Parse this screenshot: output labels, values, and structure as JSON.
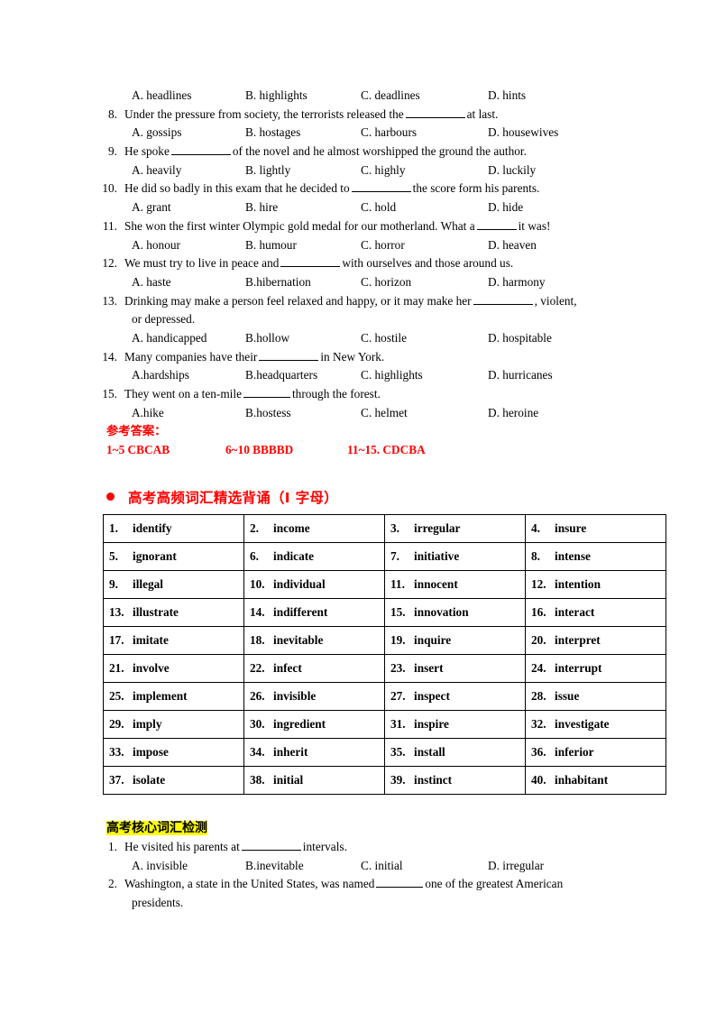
{
  "document": {
    "title": "高考词汇练习 - I 字母",
    "colors": {
      "answer_red": "#FF0000",
      "highlight_yellow": "#FFFF00",
      "text_black": "#000000"
    }
  },
  "quiz_top": {
    "orphan_options": [
      "A. headlines",
      "B. highlights",
      "C. deadlines",
      "D. hints"
    ],
    "questions": [
      {
        "num": "8.",
        "stem_before": "Under the pressure from society, the terrorists released the",
        "blank": "long",
        "stem_after": "at last.",
        "options": [
          "A. gossips",
          "B. hostages",
          "C. harbours",
          "D. housewives"
        ]
      },
      {
        "num": "9.",
        "stem_before": "He spoke",
        "blank": "long",
        "stem_after": "of the novel and he almost worshipped the ground the author.",
        "options": [
          "A. heavily",
          "B. lightly",
          "C. highly",
          "D. luckily"
        ]
      },
      {
        "num": "10.",
        "stem_before": "He did so badly in this exam that he decided to",
        "blank": "long",
        "stem_after": "the score form his parents.",
        "options": [
          "A. grant",
          "B. hire",
          "C. hold",
          "D. hide"
        ]
      },
      {
        "num": "11.",
        "stem_before": "She won the first winter Olympic gold medal for our motherland. What a",
        "blank": "short",
        "stem_after": "it was!",
        "options": [
          "A. honour",
          "B. humour",
          "C. horror",
          "D. heaven"
        ]
      },
      {
        "num": "12.",
        "stem_before": "We must try to live in peace and",
        "blank": "long",
        "stem_after": "with ourselves and those around us.",
        "options": [
          "A. haste",
          "B.hibernation",
          "C. horizon",
          "D. harmony"
        ]
      },
      {
        "num": "13.",
        "stem_before": "Drinking may make a person feel relaxed and happy, or it may make her",
        "blank": "long",
        "stem_after": ", violent,",
        "continuation": "or depressed.",
        "options": [
          "A. handicapped",
          "B.hollow",
          "C. hostile",
          "D. hospitable"
        ]
      },
      {
        "num": "14.",
        "stem_before": "Many companies have their",
        "blank": "long",
        "stem_after": "in New York.",
        "options": [
          "A.hardships",
          "B.headquarters",
          "C. highlights",
          "D. hurricanes"
        ]
      },
      {
        "num": "15.",
        "stem_before": "They went on a ten-mile",
        "blank": "mid",
        "stem_after": "through the forest.",
        "options": [
          "A.hike",
          "B.hostess",
          "C. helmet",
          "D. heroine"
        ]
      }
    ]
  },
  "answer_key": {
    "title": "参考答案：",
    "segments": [
      "1~5    CBCAB",
      "6~10   BBBBD",
      "11~15. CDCBA"
    ]
  },
  "vocab_section": {
    "heading": "高考高频词汇精选背诵（Ⅰ 字母）",
    "bullet_icon": "bullet-dot-icon",
    "rows": [
      [
        {
          "num": "1.",
          "word": "identify"
        },
        {
          "num": "2.",
          "word": "income"
        },
        {
          "num": "3.",
          "word": "irregular"
        },
        {
          "num": "4.",
          "word": "insure"
        }
      ],
      [
        {
          "num": "5.",
          "word": "ignorant"
        },
        {
          "num": "6.",
          "word": "indicate"
        },
        {
          "num": "7.",
          "word": "initiative"
        },
        {
          "num": "8.",
          "word": "intense"
        }
      ],
      [
        {
          "num": "9.",
          "word": "illegal"
        },
        {
          "num": "10.",
          "word": "individual"
        },
        {
          "num": "11.",
          "word": "innocent"
        },
        {
          "num": "12.",
          "word": "intention"
        }
      ],
      [
        {
          "num": "13.",
          "word": "illustrate"
        },
        {
          "num": "14.",
          "word": "indifferent"
        },
        {
          "num": "15.",
          "word": "innovation"
        },
        {
          "num": "16.",
          "word": "interact"
        }
      ],
      [
        {
          "num": "17.",
          "word": "imitate"
        },
        {
          "num": "18.",
          "word": "inevitable"
        },
        {
          "num": "19.",
          "word": "inquire"
        },
        {
          "num": "20.",
          "word": "interpret"
        }
      ],
      [
        {
          "num": "21.",
          "word": "involve"
        },
        {
          "num": "22.",
          "word": "infect"
        },
        {
          "num": "23.",
          "word": "insert"
        },
        {
          "num": "24.",
          "word": "interrupt"
        }
      ],
      [
        {
          "num": "25.",
          "word": "implement"
        },
        {
          "num": "26.",
          "word": "invisible"
        },
        {
          "num": "27.",
          "word": "inspect"
        },
        {
          "num": "28.",
          "word": "issue"
        }
      ],
      [
        {
          "num": "29.",
          "word": "imply"
        },
        {
          "num": "30.",
          "word": "ingredient"
        },
        {
          "num": "31.",
          "word": "inspire"
        },
        {
          "num": "32.",
          "word": "investigate"
        }
      ],
      [
        {
          "num": "33.",
          "word": "impose"
        },
        {
          "num": "34.",
          "word": "inherit"
        },
        {
          "num": "35.",
          "word": "install"
        },
        {
          "num": "36.",
          "word": "inferior"
        }
      ],
      [
        {
          "num": "37.",
          "word": "isolate"
        },
        {
          "num": "38.",
          "word": "initial"
        },
        {
          "num": "39.",
          "word": "instinct"
        },
        {
          "num": "40.",
          "word": "inhabitant"
        }
      ]
    ]
  },
  "core_test": {
    "heading": "高考核心词汇检测",
    "questions": [
      {
        "num": "1.",
        "stem_before": "He visited his parents at",
        "blank": "long",
        "stem_after": "intervals.",
        "options": [
          "A.  invisible",
          "B.inevitable",
          "C. initial",
          "D. irregular"
        ]
      },
      {
        "num": "2.",
        "stem_before": "Washington, a state in the United States, was named",
        "blank": "mid",
        "stem_after": "one of the greatest American",
        "continuation": "presidents.",
        "options": []
      }
    ]
  }
}
